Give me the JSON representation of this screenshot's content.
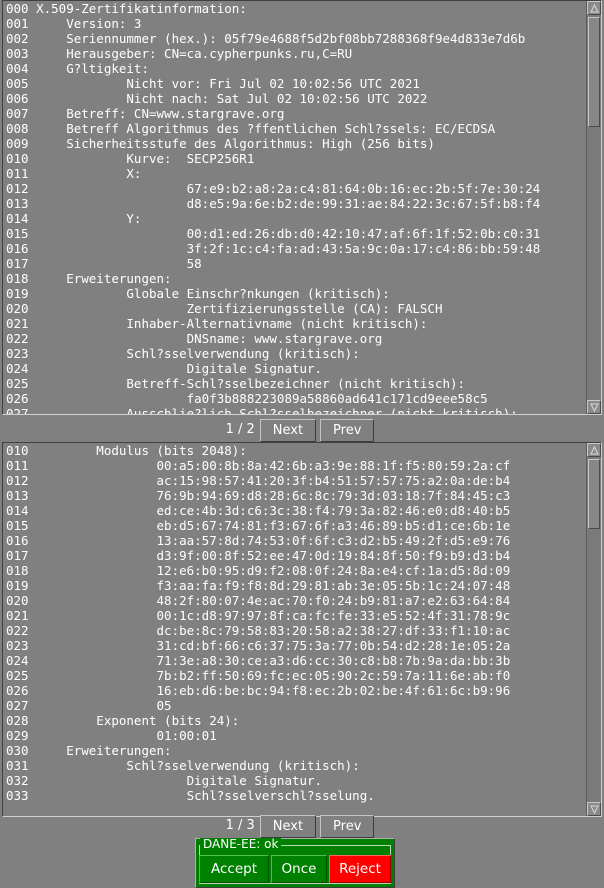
{
  "window": {
    "title": "X.509-Zertifikatinformation",
    "background_color": "#808080",
    "text_color": "#ffffff"
  },
  "panel1": {
    "name": "certificate-detail-panel",
    "lines": [
      {
        "num": "000",
        "text": "X.509-Zertifikatinformation:"
      },
      {
        "num": "001",
        "text": "    Version: 3"
      },
      {
        "num": "002",
        "text": "    Seriennummer (hex.): 05f79e4688f5d2bf08bb7288368f9e4d833e7d6b"
      },
      {
        "num": "003",
        "text": "    Herausgeber: CN=ca.cypherpunks.ru,C=RU"
      },
      {
        "num": "004",
        "text": "    G?ltigkeit:"
      },
      {
        "num": "005",
        "text": "            Nicht vor: Fri Jul 02 10:02:56 UTC 2021"
      },
      {
        "num": "006",
        "text": "            Nicht nach: Sat Jul 02 10:02:56 UTC 2022"
      },
      {
        "num": "007",
        "text": "    Betreff: CN=www.stargrave.org"
      },
      {
        "num": "008",
        "text": "    Betreff Algorithmus des ?ffentlichen Schl?ssels: EC/ECDSA"
      },
      {
        "num": "009",
        "text": "    Sicherheitsstufe des Algorithmus: High (256 bits)"
      },
      {
        "num": "010",
        "text": "            Kurve:  SECP256R1"
      },
      {
        "num": "011",
        "text": "            X:"
      },
      {
        "num": "012",
        "text": "                    67:e9:b2:a8:2a:c4:81:64:0b:16:ec:2b:5f:7e:30:24"
      },
      {
        "num": "013",
        "text": "                    d8:e5:9a:6e:b2:de:99:31:ae:84:22:3c:67:5f:b8:f4"
      },
      {
        "num": "014",
        "text": "            Y:"
      },
      {
        "num": "015",
        "text": "                    00:d1:ed:26:db:d0:42:10:47:af:6f:1f:52:0b:c0:31"
      },
      {
        "num": "016",
        "text": "                    3f:2f:1c:c4:fa:ad:43:5a:9c:0a:17:c4:86:bb:59:48"
      },
      {
        "num": "017",
        "text": "                    58"
      },
      {
        "num": "018",
        "text": "    Erweiterungen:"
      },
      {
        "num": "019",
        "text": "            Globale Einschr?nkungen (kritisch):"
      },
      {
        "num": "020",
        "text": "                    Zertifizierungsstelle (CA): FALSCH"
      },
      {
        "num": "021",
        "text": "            Inhaber-Alternativname (nicht kritisch):"
      },
      {
        "num": "022",
        "text": "                    DNSname: www.stargrave.org"
      },
      {
        "num": "023",
        "text": "            Schl?sselverwendung (kritisch):"
      },
      {
        "num": "024",
        "text": "                    Digitale Signatur."
      },
      {
        "num": "025",
        "text": "            Betreff-Schl?sselbezeichner (nicht kritisch):"
      },
      {
        "num": "026",
        "text": "                    fa0f3b888223089a58860ad641c171cd9eee58c5"
      },
      {
        "num": "027",
        "text": "            Ausschlie?lich Schl?sselbezeichner (nicht kritisch):"
      }
    ]
  },
  "pager1": {
    "page_label": "1 / 2",
    "next_label": "Next",
    "prev_label": "Prev"
  },
  "panel2": {
    "name": "public-key-detail-panel",
    "lines": [
      {
        "num": "010",
        "text": "        Modulus (bits 2048):"
      },
      {
        "num": "011",
        "text": "                00:a5:00:8b:8a:42:6b:a3:9e:88:1f:f5:80:59:2a:cf"
      },
      {
        "num": "012",
        "text": "                ac:15:98:57:41:20:3f:b4:51:57:57:75:a2:0a:de:b4"
      },
      {
        "num": "013",
        "text": "                76:9b:94:69:d8:28:6c:8c:79:3d:03:18:7f:84:45:c3"
      },
      {
        "num": "014",
        "text": "                ed:ce:4b:3d:c6:3c:38:f4:79:3a:82:46:e0:d8:40:b5"
      },
      {
        "num": "015",
        "text": "                eb:d5:67:74:81:f3:67:6f:a3:46:89:b5:d1:ce:6b:1e"
      },
      {
        "num": "016",
        "text": "                13:aa:57:8d:74:53:0f:6f:c3:d2:b5:49:2f:d5:e9:76"
      },
      {
        "num": "017",
        "text": "                d3:9f:00:8f:52:ee:47:0d:19:84:8f:50:f9:b9:d3:b4"
      },
      {
        "num": "018",
        "text": "                12:e6:b0:95:d9:f2:08:0f:24:8a:e4:cf:1a:d5:8d:09"
      },
      {
        "num": "019",
        "text": "                f3:aa:fa:f9:f8:8d:29:81:ab:3e:05:5b:1c:24:07:48"
      },
      {
        "num": "020",
        "text": "                48:2f:80:07:4e:ac:70:f0:24:b9:81:a7:e2:63:64:84"
      },
      {
        "num": "021",
        "text": "                00:1c:d8:97:97:8f:ca:fc:fe:33:e5:52:4f:31:78:9c"
      },
      {
        "num": "022",
        "text": "                dc:be:8c:79:58:83:20:58:a2:38:27:df:33:f1:10:ac"
      },
      {
        "num": "023",
        "text": "                31:cd:bf:66:c6:37:75:3a:77:0b:54:d2:28:1e:05:2a"
      },
      {
        "num": "024",
        "text": "                71:3e:a8:30:ce:a3:d6:cc:30:c8:b8:7b:9a:da:bb:3b"
      },
      {
        "num": "025",
        "text": "                7b:b2:ff:50:69:fc:ec:05:90:2c:59:7a:11:6e:ab:f0"
      },
      {
        "num": "026",
        "text": "                16:eb:d6:be:bc:94:f8:ec:2b:02:be:4f:61:6c:b9:96"
      },
      {
        "num": "027",
        "text": "                05"
      },
      {
        "num": "028",
        "text": "        Exponent (bits 24):"
      },
      {
        "num": "029",
        "text": "                01:00:01"
      },
      {
        "num": "030",
        "text": "    Erweiterungen:"
      },
      {
        "num": "031",
        "text": "            Schl?sselverwendung (kritisch):"
      },
      {
        "num": "032",
        "text": "                    Digitale Signatur."
      },
      {
        "num": "033",
        "text": "                    Schl?sselverschl?sselung."
      }
    ]
  },
  "pager2": {
    "page_label": "1 / 3",
    "next_label": "Next",
    "prev_label": "Prev"
  },
  "dane_dialog": {
    "legend": "DANE-EE: ok",
    "accept_label": "Accept",
    "once_label": "Once",
    "reject_label": "Reject",
    "frame_color": "#008000",
    "reject_color": "#ff0000"
  },
  "scrollbar": {
    "up_icon": "triangle-up-icon",
    "down_icon": "triangle-down-icon"
  }
}
